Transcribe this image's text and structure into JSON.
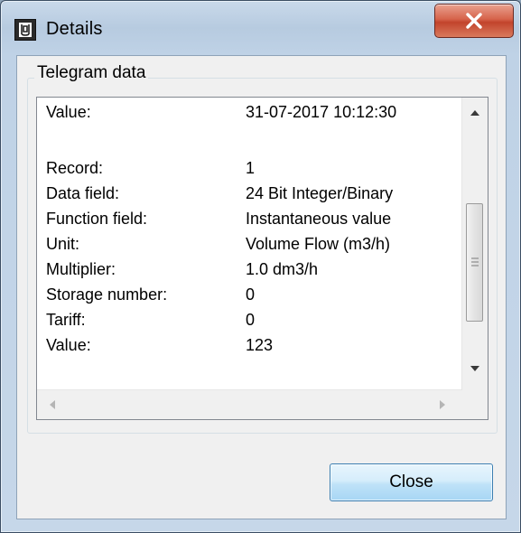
{
  "window": {
    "title": "Details",
    "close_glyph": "X",
    "icon": "app-icon"
  },
  "group": {
    "legend": "Telegram data"
  },
  "details": {
    "rows": [
      {
        "label": "Value:",
        "value": "31-07-2017  10:12:30"
      },
      {
        "label": "",
        "value": ""
      },
      {
        "label": "Record:",
        "value": "1"
      },
      {
        "label": "Data field:",
        "value": "24 Bit Integer/Binary"
      },
      {
        "label": "Function field:",
        "value": "Instantaneous value"
      },
      {
        "label": "Unit:",
        "value": "Volume Flow (m3/h)"
      },
      {
        "label": "Multiplier:",
        "value": "1.0 dm3/h"
      },
      {
        "label": "Storage number:",
        "value": "0"
      },
      {
        "label": "Tariff:",
        "value": "0"
      },
      {
        "label": "Value:",
        "value": "123"
      }
    ]
  },
  "buttons": {
    "close_label": "Close"
  },
  "colors": {
    "title_bar": "#c9d9ea",
    "close_button_red": "#c2442c",
    "button_blue": "#bfe2f8"
  }
}
